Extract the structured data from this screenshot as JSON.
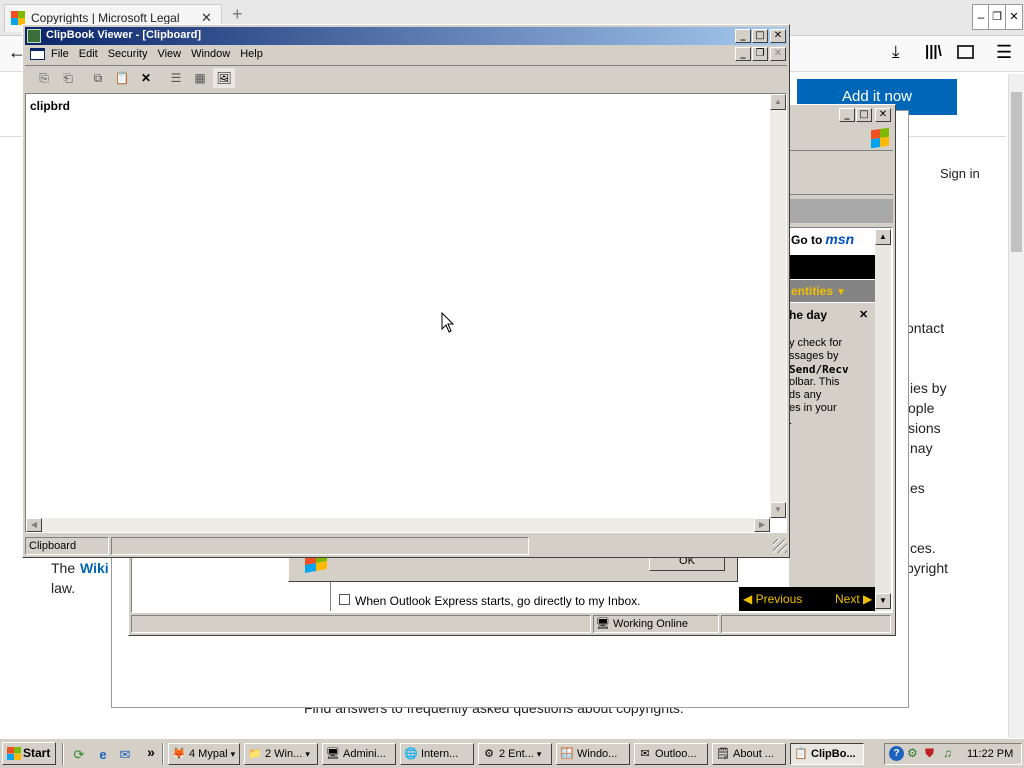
{
  "browser": {
    "tab_title": "Copyrights | Microsoft Legal",
    "tab_close": "✕",
    "new_tab": "+",
    "add_it_now": "Add it now",
    "sign_in": "Sign in",
    "body_fragments": [
      "ontact",
      "ies by",
      "ople",
      "sions",
      "nay",
      "es",
      "ces.",
      "pyright"
    ],
    "the": "The",
    "wiki": "Wiki",
    "law": "law.",
    "footer_text": "Find answers to frequently asked questions about copyrights.",
    "window_min": "‒",
    "window_restore": "❐",
    "window_close": "✕"
  },
  "outlook": {
    "goto_msn": "Go to",
    "msn_logo": "msn",
    "identities": "entities",
    "tip_title": "he day",
    "tip_close": "✕",
    "tip_lines": [
      "y check for",
      "ssages by",
      "Send/Recv",
      "olbar. This",
      "ds any",
      "es in your",
      "."
    ],
    "previous": "Previous",
    "next": "Next",
    "startup_checkbox": "When Outlook Express starts, go directly to my Inbox.",
    "ok_button": "OK",
    "status_online": "Working Online"
  },
  "clipbook": {
    "title": "ClipBook Viewer - [Clipboard]",
    "menu": [
      "File",
      "Edit",
      "Security",
      "View",
      "Window",
      "Help"
    ],
    "content_text": "clipbrd",
    "status": "Clipboard",
    "min": "_",
    "max": "□",
    "close": "✕"
  },
  "taskbar": {
    "start": "Start",
    "overflow": "»",
    "buttons": [
      {
        "label": "4 Mypal",
        "icon": "🦊",
        "arrow": "▾"
      },
      {
        "label": "2 Win...",
        "icon": "📁",
        "arrow": "▾"
      },
      {
        "label": "Admini...",
        "icon": "🖥"
      },
      {
        "label": "Intern...",
        "icon": "🌐"
      },
      {
        "label": "2 Ent...",
        "icon": "⚙",
        "arrow": "▾"
      },
      {
        "label": "Windo...",
        "icon": "🪟"
      },
      {
        "label": "Outloo...",
        "icon": "✉"
      },
      {
        "label": "About ...",
        "icon": "🗒"
      },
      {
        "label": "ClipBo...",
        "icon": "📋"
      }
    ],
    "clock": "11:22 PM"
  },
  "colors": {
    "title_active": "#0a246a",
    "title_active_end": "#a6caf0",
    "face": "#d4d0c8",
    "link": "#0066b4",
    "add_button": "#0067b8",
    "msn_bar": "#000000",
    "identities_bar": "#848484",
    "identities_text": "#f0c000"
  }
}
